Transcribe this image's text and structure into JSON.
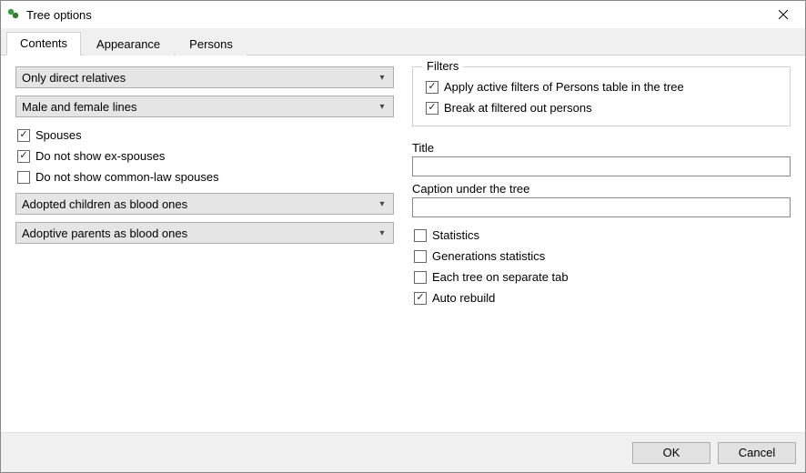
{
  "window": {
    "title": "Tree options"
  },
  "tabs": {
    "contents": "Contents",
    "appearance": "Appearance",
    "persons": "Persons",
    "active": "contents"
  },
  "left": {
    "relatives_combo": "Only direct relatives",
    "lines_combo": "Male and female lines",
    "chk_spouses": {
      "label": "Spouses",
      "checked": true
    },
    "chk_no_ex": {
      "label": "Do not show ex-spouses",
      "checked": true
    },
    "chk_no_common_law": {
      "label": "Do not show common-law spouses",
      "checked": false
    },
    "adopted_children_combo": "Adopted children as blood ones",
    "adoptive_parents_combo": "Adoptive parents as blood ones"
  },
  "right": {
    "filters_legend": "Filters",
    "chk_apply_filters": {
      "label": "Apply active filters of Persons table in the tree",
      "checked": true
    },
    "chk_break_filtered": {
      "label": "Break at filtered out persons",
      "checked": true
    },
    "title_label": "Title",
    "title_value": "",
    "caption_label": "Caption under the tree",
    "caption_value": "",
    "chk_statistics": {
      "label": "Statistics",
      "checked": false
    },
    "chk_gen_stats": {
      "label": "Generations statistics",
      "checked": false
    },
    "chk_separate_tab": {
      "label": "Each tree on separate tab",
      "checked": false
    },
    "chk_auto_rebuild": {
      "label": "Auto rebuild",
      "checked": true
    }
  },
  "buttons": {
    "ok": "OK",
    "cancel": "Cancel"
  }
}
